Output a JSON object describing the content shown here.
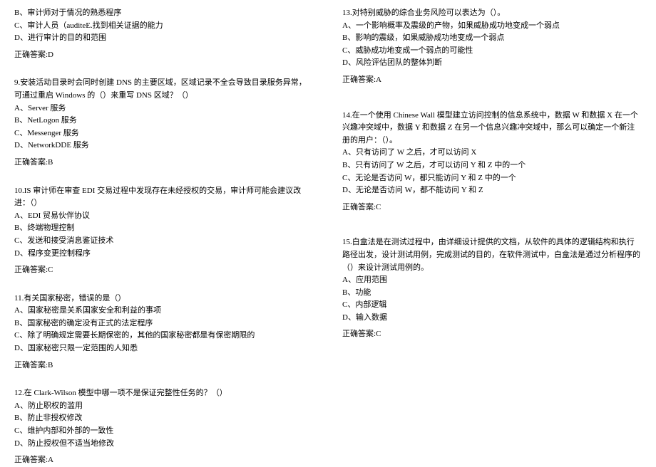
{
  "left_column": {
    "q8_partial": {
      "options": [
        "B、审计师对于情况的熟悉程序",
        "C、审计人员（auditeE.找到相关证据的能力",
        "D、进行审计的目的和范围"
      ],
      "answer": "正确答案:D"
    },
    "q9": {
      "text": "9.安装活动目录时会同时创建 DNS 的主要区域，区域记录不全会导致目录服务异常，可通过重启 Windows 的（）来重写 DNS 区域？（）",
      "options": [
        "A、Server 服务",
        "B、NetLogon 服务",
        "C、Messenger 服务",
        "D、NetworkDDE 服务"
      ],
      "answer": "正确答案:B"
    },
    "q10": {
      "text": "10.IS 审计师在审查 EDI 交易过程中发现存在未经授权的交易，审计师可能会建议改进：（）",
      "options": [
        "A、EDI 贸易伙伴协议",
        "B、终端物理控制",
        "C、发送和接受消息鉴证技术",
        "D、程序变更控制程序"
      ],
      "answer": "正确答案:C"
    },
    "q11": {
      "text": "11.有关国家秘密，错误的是（）",
      "options": [
        "A、国家秘密是关系国家安全和利益的事项",
        "B、国家秘密的确定没有正式的法定程序",
        "C、除了明确规定需要长期保密的，其他的国家秘密都是有保密期限的",
        "D、国家秘密只限一定范围的人知悉"
      ],
      "answer": "正确答案:B"
    },
    "q12": {
      "text": "12.在 Clark-Wilson 模型中哪一项不是保证完整性任务的？（）",
      "options": [
        "A、防止职权的滥用",
        "B、防止非授权修改",
        "C、维护内部和外部的一致性",
        "D、防止授权但不适当地修改"
      ],
      "answer": "正确答案:A"
    }
  },
  "right_column": {
    "q13": {
      "text": "13.对特别威胁的综合业务风险可以表达为（）。",
      "options": [
        "A、一个影响概率及震级的产物，如果威胁成功地变成一个弱点",
        "B、影响的震级，如果威胁成功地变成一个弱点",
        "C、威胁成功地变成一个弱点的可能性",
        "D、风险评估团队的整体判断"
      ],
      "answer": "正确答案:A"
    },
    "q14": {
      "text": "14.在一个使用 Chinese Wall 模型建立访问控制的信息系统中，数据 W 和数据 X 在一个兴趣冲突域中，数据 Y 和数据 Z 在另一个信息兴趣冲突域中，那么可以确定一个新注册的用户：（）。",
      "options": [
        "A、只有访问了 W 之后，才可以访问 X",
        "B、只有访问了 W 之后，才可以访问 Y 和 Z 中的一个",
        "C、无论是否访问 W，都只能访问 Y 和 Z 中的一个",
        "D、无论是否访问 W，都不能访问 Y 和 Z"
      ],
      "answer": "正确答案:C"
    },
    "q15": {
      "text": "15.白盒法是在测试过程中，由详细设计提供的文档，从软件的具体的逻辑结构和执行路径出发，设计测试用例，完成测试的目的，在软件测试中，白盒法是通过分析程序的（）来设计测试用例的。",
      "options": [
        "A、应用范围",
        "B、功能",
        "C、内部逻辑",
        "D、输入数据"
      ],
      "answer": "正确答案:C"
    }
  }
}
